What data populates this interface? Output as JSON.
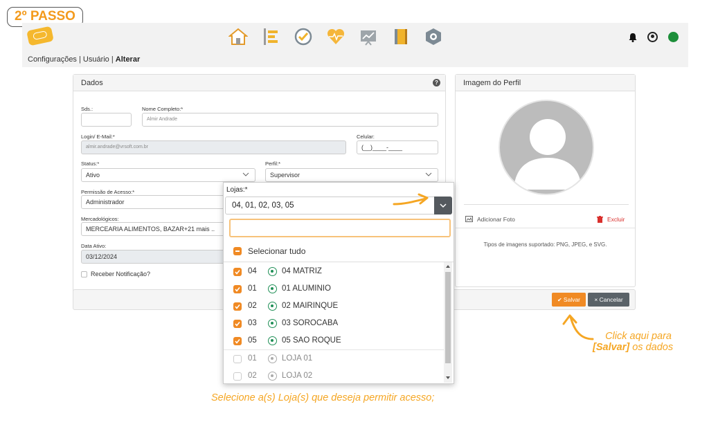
{
  "step_badge": "2º PASSO",
  "header": {
    "nav_icons": [
      "home-icon",
      "list-icon",
      "check-circle-icon",
      "heart-pulse-icon",
      "chart-board-icon",
      "notebook-icon",
      "hexagon-gear-icon"
    ],
    "right_icons": [
      "bell-icon",
      "user-circle-icon",
      "online-status-dot"
    ],
    "status_color": "#1d8f3a"
  },
  "breadcrumb": {
    "path": "Configurações | Usuário | ",
    "current": "Alterar"
  },
  "dados": {
    "title": "Dados",
    "help": "?",
    "sds_label": "Sds.:",
    "sds_value": "",
    "nome_label": "Nome Completo:*",
    "nome_value": "Almir Andrade",
    "login_label": "Login/ E-Mail:*",
    "login_value": "almir.andrade@vrsoft.com.br",
    "celular_label": "Celular:",
    "celular_value": "(__)____-____",
    "status_label": "Status:*",
    "status_value": "Ativo",
    "perfil_label": "Perfil:*",
    "perfil_value": "Supervisor",
    "permissao_label": "Permissão de Acesso:*",
    "permissao_value": "Administrador",
    "mercadologicos_label": "Mercadológicos:",
    "mercadologicos_value": "MERCEARIA ALIMENTOS, BAZAR+21 mais ..",
    "data_ativo_label": "Data Ativo:",
    "data_ativo_value": "03/12/2024",
    "notificacao_label": "Receber Notificação?"
  },
  "perfil_imagem": {
    "title": "Imagem do Perfil",
    "add_photo": "Adicionar Foto",
    "delete": "Excluir",
    "hint": "Tipos de imagens suportado: PNG, JPEG, e SVG."
  },
  "actions": {
    "save": "Salvar",
    "cancel": "Cancelar"
  },
  "lojas": {
    "label": "Lojas:*",
    "selected": "04, 01, 02, 03, 05",
    "search_placeholder": "",
    "select_all": "Selecionar tudo",
    "items": [
      {
        "code": "04",
        "name": "04 MATRIZ",
        "checked": true
      },
      {
        "code": "01",
        "name": "01 ALUMINIO",
        "checked": true
      },
      {
        "code": "02",
        "name": "02 MAIRINQUE",
        "checked": true
      },
      {
        "code": "03",
        "name": "03 SOROCABA",
        "checked": true
      },
      {
        "code": "05",
        "name": "05 SAO ROQUE",
        "checked": true
      },
      {
        "code": "01",
        "name": "LOJA 01",
        "checked": false
      },
      {
        "code": "02",
        "name": "LOJA 02",
        "checked": false
      }
    ]
  },
  "annotations": {
    "save_hint_line1": "Click aqui para",
    "save_hint_bold": "[Salvar]",
    "save_hint_line2_rest": " os dados",
    "lojas_hint": "Selecione a(s) Loja(s) que deseja permitir acesso;"
  },
  "colors": {
    "accent": "#f08a24",
    "annotation": "#f5a623",
    "cancel": "#5a6268"
  }
}
